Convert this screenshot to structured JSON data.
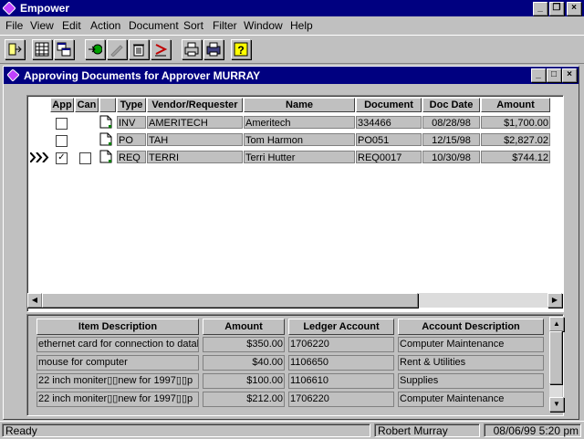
{
  "app": {
    "title": "Empower",
    "minimize": "_",
    "restore": "❐",
    "close": "×"
  },
  "menu": [
    {
      "label": "File"
    },
    {
      "label": "View"
    },
    {
      "label": "Edit"
    },
    {
      "label": "Action"
    },
    {
      "label": "Document"
    },
    {
      "label": "Sort"
    },
    {
      "label": "Filter"
    },
    {
      "label": "Window"
    },
    {
      "label": "Help"
    }
  ],
  "toolbar_icons": [
    "exit-icon",
    "grid-icon",
    "cascade-icon",
    "approve-icon",
    "edit-icon",
    "delete-icon",
    "reject-icon",
    "print-icon",
    "print-preview-icon",
    "help-icon"
  ],
  "child": {
    "title": "Approving Documents for Approver MURRAY"
  },
  "documents": {
    "columns": [
      "App",
      "Can",
      "",
      "Type",
      "Vendor/Requester",
      "Name",
      "Document",
      "Doc Date",
      "Amount"
    ],
    "rows": [
      {
        "current": false,
        "app": false,
        "can": null,
        "type": "INV",
        "vendor": "AMERITECH",
        "name": "Ameritech",
        "document": "334466",
        "date": "08/28/98",
        "amount": "$1,700.00"
      },
      {
        "current": false,
        "app": false,
        "can": null,
        "type": "PO",
        "vendor": "TAH",
        "name": "Tom Harmon",
        "document": "PO051",
        "date": "12/15/98",
        "amount": "$2,827.02"
      },
      {
        "current": true,
        "app": true,
        "can": false,
        "type": "REQ",
        "vendor": "TERRI",
        "name": "Terri Hutter",
        "document": "REQ0017",
        "date": "10/30/98",
        "amount": "$744.12"
      }
    ]
  },
  "items": {
    "columns": [
      "Item Description",
      "Amount",
      "Ledger Account",
      "Account Description"
    ],
    "rows": [
      {
        "desc": "ethernet card for connection to datal",
        "amount": "$350.00",
        "ledger": "1706220",
        "account": "Computer Maintenance"
      },
      {
        "desc": "mouse for computer",
        "amount": "$40.00",
        "ledger": "1106650",
        "account": "Rent & Utilities"
      },
      {
        "desc": "22 inch moniter▯▯new for 1997▯▯p",
        "amount": "$100.00",
        "ledger": "1106610",
        "account": "Supplies"
      },
      {
        "desc": "22 inch moniter▯▯new for 1997▯▯p",
        "amount": "$212.00",
        "ledger": "1706220",
        "account": "Computer Maintenance"
      }
    ]
  },
  "status": {
    "ready": "Ready",
    "user": "Robert Murray",
    "datetime": "08/06/99 5:20 pm"
  }
}
